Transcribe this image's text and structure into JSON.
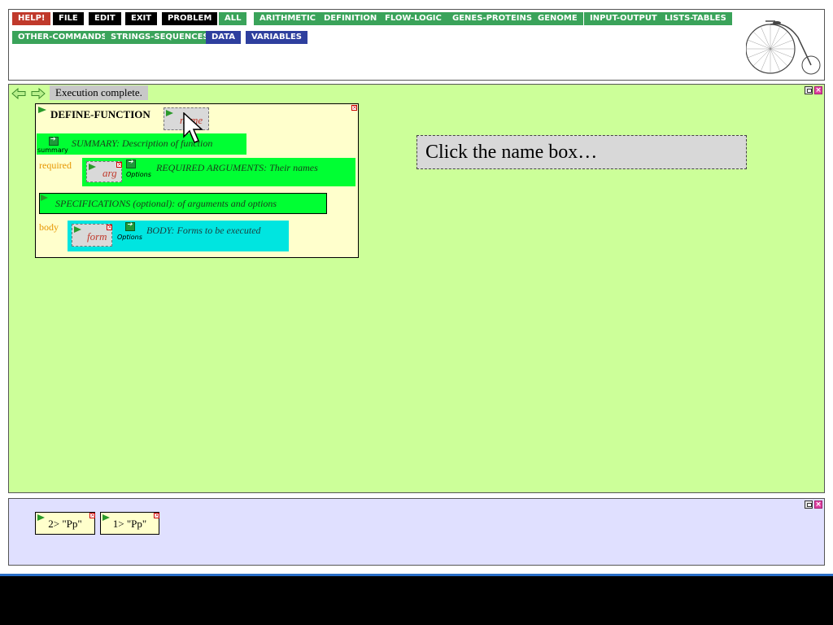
{
  "menu": {
    "buttons": [
      {
        "label": "HELP!",
        "color": "#c0392b"
      },
      {
        "label": "FILE",
        "color": "#000000"
      },
      {
        "label": "EDIT",
        "color": "#000000"
      },
      {
        "label": "EXIT",
        "color": "#000000"
      },
      {
        "label": "PROBLEM",
        "color": "#000000"
      },
      {
        "label": "ALL",
        "color": "#3aa35a"
      },
      {
        "label": "ARITHMETIC",
        "color": "#3aa35a"
      },
      {
        "label": "DEFINITION",
        "color": "#3aa35a"
      },
      {
        "label": "FLOW-LOGIC",
        "color": "#3aa35a"
      },
      {
        "label": "GENES-PROTEINS",
        "color": "#3aa35a"
      },
      {
        "label": "GENOME",
        "color": "#3aa35a"
      },
      {
        "label": "INPUT-OUTPUT",
        "color": "#3aa35a"
      },
      {
        "label": "LISTS-TABLES",
        "color": "#3aa35a"
      },
      {
        "label": "OTHER-COMMANDS",
        "color": "#3aa35a"
      },
      {
        "label": "STRINGS-SEQUENCES",
        "color": "#3aa35a"
      },
      {
        "label": "DATA",
        "color": "#2e3f9e"
      },
      {
        "label": "VARIABLES",
        "color": "#2e3f9e"
      }
    ],
    "logo_icon": "penny-farthing-bicycle-icon"
  },
  "workspace": {
    "background": "#ccff99",
    "status": "Execution complete.",
    "nav": {
      "back_icon": "back-arrow-icon",
      "forward_icon": "forward-arrow-icon"
    },
    "define_function": {
      "title": "DEFINE-FUNCTION",
      "name_slot": "name",
      "summary_icon_label": "summary",
      "summary_text": "SUMMARY: Description of function",
      "required_label": "required",
      "arg_slot": "arg",
      "required_options_label": "Options",
      "required_text": "REQUIRED ARGUMENTS: Their names",
      "specifications_text": "SPECIFICATIONS (optional): of arguments and options",
      "body_label": "body",
      "form_slot": "form",
      "body_options_label": "Options",
      "body_text": "BODY: Forms to be executed"
    },
    "instruction": "Click the name box…"
  },
  "results": {
    "background": "#e0e0ff",
    "items": [
      {
        "text": "2> \"Pp\""
      },
      {
        "text": "1> \"Pp\""
      }
    ]
  }
}
